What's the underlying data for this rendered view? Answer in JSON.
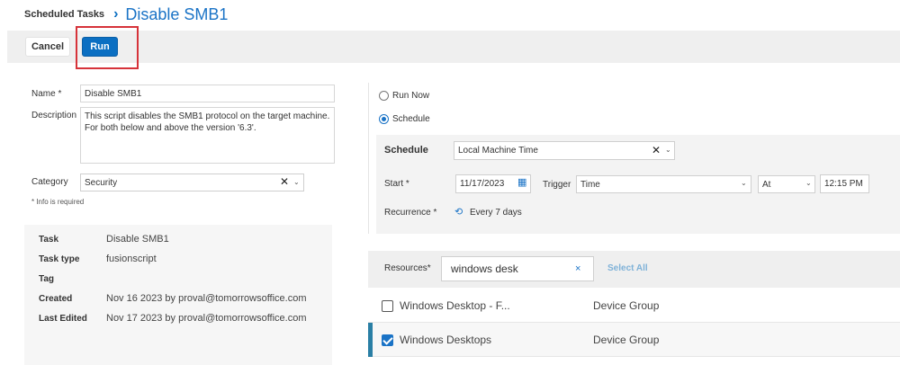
{
  "breadcrumb": {
    "root": "Scheduled Tasks",
    "separator": "›",
    "current": "Disable SMB1"
  },
  "toolbar": {
    "cancel_label": "Cancel",
    "run_label": "Run"
  },
  "form": {
    "name_label": "Name *",
    "name_value": "Disable SMB1",
    "description_label": "Description",
    "description_value": "This script disables the SMB1 protocol on the target machine. For both below and above the version '6.3'.",
    "category_label": "Category",
    "category_value": "Security",
    "info_note": "* Info is required"
  },
  "summary": {
    "task_label": "Task",
    "task_value": "Disable SMB1",
    "type_label": "Task type",
    "type_value": "fusionscript",
    "tag_label": "Tag",
    "tag_value": "",
    "created_label": "Created",
    "created_value": "Nov 16 2023 by proval@tomorrowsoffice.com",
    "edited_label": "Last Edited",
    "edited_value": "Nov 17 2023 by proval@tomorrowsoffice.com"
  },
  "schedule": {
    "run_now_label": "Run Now",
    "schedule_label": "Schedule",
    "selected_mode": "Schedule",
    "schedule_field_label": "Schedule",
    "timezone_value": "Local Machine Time",
    "start_label": "Start *",
    "start_date": "11/17/2023",
    "trigger_label": "Trigger",
    "trigger_value": "Time",
    "at_value": "At",
    "time_value": "12:15 PM",
    "recurrence_label": "Recurrence *",
    "recurrence_value": "Every 7 days"
  },
  "resources": {
    "label": "Resources*",
    "search_value": "windows desk",
    "clear_label": "×",
    "select_all_label": "Select All",
    "rows": [
      {
        "name": "Windows Desktop - F...",
        "type": "Device Group",
        "checked": false
      },
      {
        "name": "Windows Desktops",
        "type": "Device Group",
        "checked": true
      }
    ]
  },
  "colors": {
    "accent": "#0b6fc2",
    "highlight": "#d6333a"
  }
}
